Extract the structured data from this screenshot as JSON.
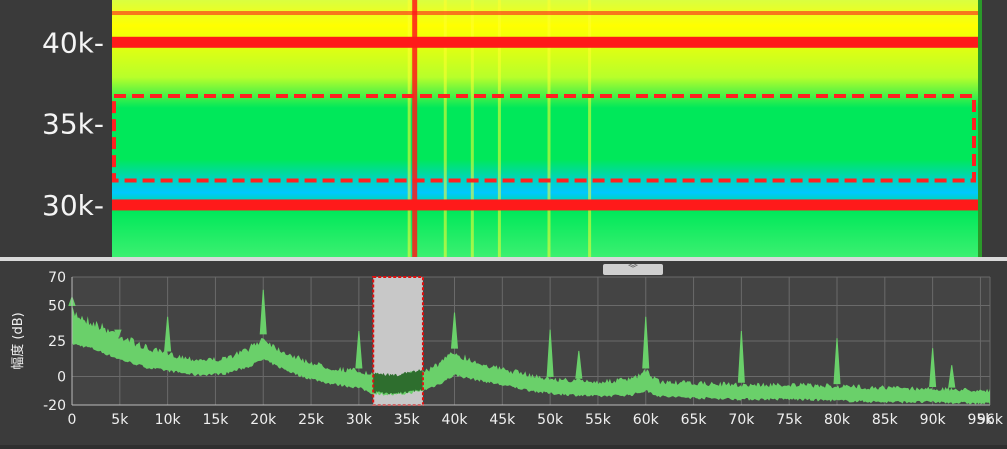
{
  "spectrogram": {
    "y_ticks": [
      {
        "label": "40k-",
        "freq": 40000
      },
      {
        "label": "35k-",
        "freq": 35000
      },
      {
        "label": "30k-",
        "freq": 30000
      }
    ],
    "freq_range": [
      26800,
      42600
    ],
    "selection_freq": [
      31500,
      36700
    ],
    "tone_lines": [
      40000,
      30000,
      41800
    ],
    "vertical_lines": [
      33500,
      33000,
      40000,
      43000,
      53000,
      37000,
      48500
    ],
    "colors": {
      "background": "#ffff00",
      "band": "#00e85a",
      "cold": "#00c8ff",
      "hot": "#ff1a1a",
      "selection": "#ff2020"
    }
  },
  "collapse_handle": {
    "glyph": "︾"
  },
  "chart_data": {
    "type": "area",
    "ylabel": "幅度 (dB)",
    "xlabel": "",
    "xlim": [
      0,
      96000
    ],
    "ylim": [
      -20,
      70
    ],
    "x_ticks": [
      {
        "label": "0",
        "value": 0
      },
      {
        "label": "5k",
        "value": 5000
      },
      {
        "label": "10k",
        "value": 10000
      },
      {
        "label": "15k",
        "value": 15000
      },
      {
        "label": "20k",
        "value": 20000
      },
      {
        "label": "25k",
        "value": 25000
      },
      {
        "label": "30k",
        "value": 30000
      },
      {
        "label": "35k",
        "value": 35000
      },
      {
        "label": "40k",
        "value": 40000
      },
      {
        "label": "45k",
        "value": 45000
      },
      {
        "label": "50k",
        "value": 50000
      },
      {
        "label": "55k",
        "value": 55000
      },
      {
        "label": "60k",
        "value": 60000
      },
      {
        "label": "65k",
        "value": 65000
      },
      {
        "label": "70k",
        "value": 70000
      },
      {
        "label": "75k",
        "value": 75000
      },
      {
        "label": "80k",
        "value": 80000
      },
      {
        "label": "85k",
        "value": 85000
      },
      {
        "label": "90k",
        "value": 90000
      },
      {
        "label": "95k",
        "value": 95000
      },
      {
        "label": "96k",
        "value": 96000
      }
    ],
    "y_ticks": [
      {
        "label": "70",
        "value": 70
      },
      {
        "label": "50",
        "value": 50
      },
      {
        "label": "25",
        "value": 25
      },
      {
        "label": "0",
        "value": 0
      },
      {
        "label": "-20",
        "value": -20
      }
    ],
    "grid": true,
    "selection": {
      "x_range": [
        31500,
        36700
      ]
    },
    "floor": [
      {
        "x": 0,
        "low": 25,
        "high": 50
      },
      {
        "x": 2000,
        "low": 22,
        "high": 42
      },
      {
        "x": 5000,
        "low": 14,
        "high": 32
      },
      {
        "x": 8000,
        "low": 8,
        "high": 22
      },
      {
        "x": 10000,
        "low": 6,
        "high": 18
      },
      {
        "x": 13000,
        "low": 3,
        "high": 14
      },
      {
        "x": 16000,
        "low": 4,
        "high": 14
      },
      {
        "x": 18500,
        "low": 9,
        "high": 22
      },
      {
        "x": 20000,
        "low": 14,
        "high": 30
      },
      {
        "x": 21500,
        "low": 9,
        "high": 22
      },
      {
        "x": 24000,
        "low": 2,
        "high": 14
      },
      {
        "x": 27000,
        "low": -3,
        "high": 8
      },
      {
        "x": 30000,
        "low": -6,
        "high": 6
      },
      {
        "x": 31500,
        "low": -10,
        "high": 3
      },
      {
        "x": 34000,
        "low": -11,
        "high": 2
      },
      {
        "x": 36700,
        "low": -8,
        "high": 6
      },
      {
        "x": 38500,
        "low": -3,
        "high": 12
      },
      {
        "x": 40000,
        "low": 3,
        "high": 20
      },
      {
        "x": 42000,
        "low": 0,
        "high": 13
      },
      {
        "x": 45000,
        "low": -4,
        "high": 7
      },
      {
        "x": 48000,
        "low": -8,
        "high": 3
      },
      {
        "x": 50000,
        "low": -10,
        "high": 0
      },
      {
        "x": 55000,
        "low": -12,
        "high": -2
      },
      {
        "x": 58500,
        "low": -11,
        "high": 0
      },
      {
        "x": 60000,
        "low": -8,
        "high": 6
      },
      {
        "x": 61500,
        "low": -12,
        "high": -2
      },
      {
        "x": 65000,
        "low": -13,
        "high": -3
      },
      {
        "x": 70000,
        "low": -14,
        "high": -4
      },
      {
        "x": 75000,
        "low": -14,
        "high": -4
      },
      {
        "x": 80000,
        "low": -15,
        "high": -5
      },
      {
        "x": 85000,
        "low": -16,
        "high": -6
      },
      {
        "x": 90000,
        "low": -16,
        "high": -7
      },
      {
        "x": 95000,
        "low": -17,
        "high": -8
      },
      {
        "x": 96000,
        "low": -17,
        "high": -8
      }
    ],
    "peaks": [
      {
        "x": 0,
        "y": 56
      },
      {
        "x": 4800,
        "y": 27
      },
      {
        "x": 10000,
        "y": 42
      },
      {
        "x": 20000,
        "y": 61
      },
      {
        "x": 30000,
        "y": 32
      },
      {
        "x": 40000,
        "y": 45
      },
      {
        "x": 50000,
        "y": 33
      },
      {
        "x": 53000,
        "y": 18
      },
      {
        "x": 60000,
        "y": 42
      },
      {
        "x": 70000,
        "y": 32
      },
      {
        "x": 80000,
        "y": 27
      },
      {
        "x": 90000,
        "y": 20
      },
      {
        "x": 92000,
        "y": 8
      }
    ],
    "colors": {
      "fill": "#6ad06a",
      "selected_fill": "#2e6e2e",
      "selection_bg": "#c8c8c8",
      "selection_border": "#e01010",
      "grid": "#6a6a6a",
      "axis_text": "#f0f0f0"
    }
  }
}
